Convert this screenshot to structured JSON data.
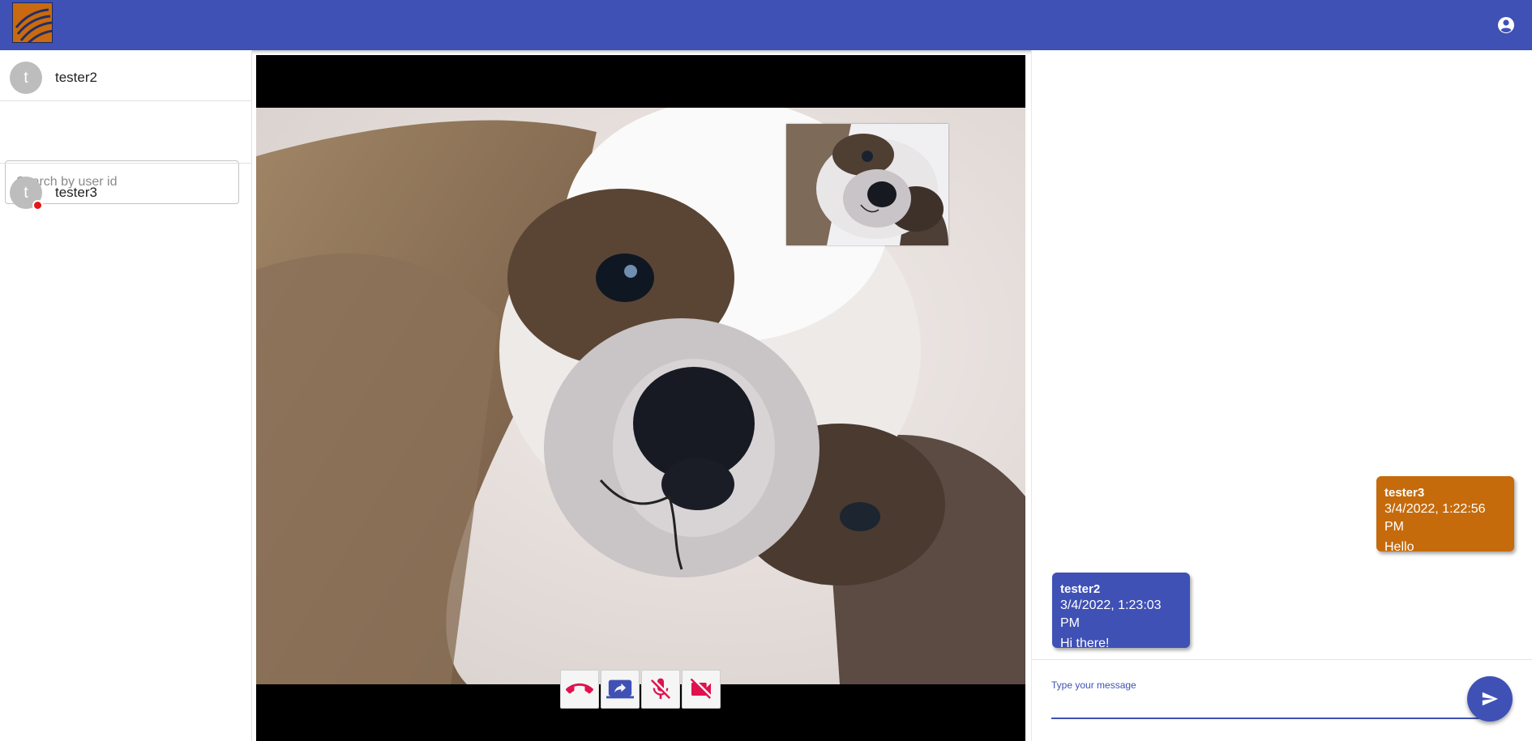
{
  "header": {
    "logo_icon": "brand-logo-icon",
    "account_icon": "account-circle-icon"
  },
  "sidebar": {
    "current_user": {
      "initial": "t",
      "name": "tester2"
    },
    "search": {
      "placeholder": "Search by user id",
      "value": ""
    },
    "contacts": [
      {
        "initial": "t",
        "name": "tester3",
        "status": "busy",
        "status_color": "#e21818"
      }
    ]
  },
  "video": {
    "remote_feed": "remote-video-stream",
    "local_feed": "local-video-preview",
    "controls": [
      {
        "icon": "hang-up-icon",
        "color": "#e0114e"
      },
      {
        "icon": "screen-share-icon",
        "color": "#3f51b5"
      },
      {
        "icon": "mic-off-icon",
        "color": "#e0114e"
      },
      {
        "icon": "videocam-off-icon",
        "color": "#e0114e"
      }
    ]
  },
  "chat": {
    "messages": [
      {
        "sender": "tester3",
        "time": "3/4/2022, 1:22:56 PM",
        "text": "Hello",
        "color": "#c56b0c",
        "side": "right"
      },
      {
        "sender": "tester2",
        "time": "3/4/2022, 1:23:03 PM",
        "text": "Hi there!",
        "color": "#3f51b5",
        "side": "left"
      }
    ],
    "input": {
      "label": "Type your message",
      "value": ""
    },
    "send_icon": "send-icon"
  },
  "colors": {
    "primary": "#3f51b5",
    "accent_orange": "#c56b0c",
    "danger": "#e0114e"
  }
}
